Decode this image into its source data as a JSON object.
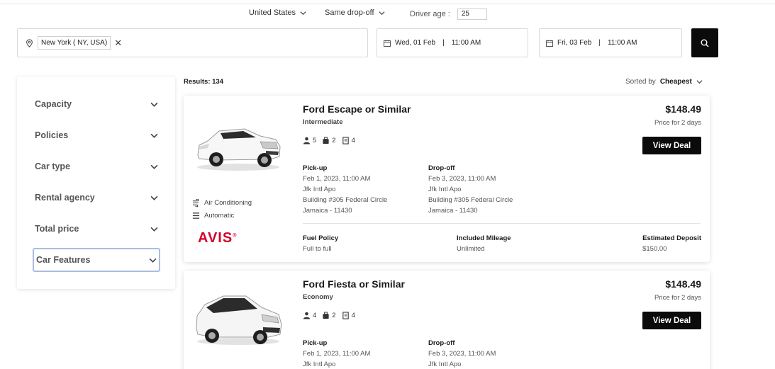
{
  "top_options": {
    "country": "United States",
    "dropoff_mode": "Same drop-off",
    "driver_age_label": "Driver age :",
    "driver_age_value": "25"
  },
  "search": {
    "location": "New York ( NY, USA)",
    "clear_symbol": "✕",
    "pickup_date": "Wed, 01 Feb",
    "pickup_time": "11:00 AM",
    "dropoff_date": "Fri, 03 Feb",
    "dropoff_time": "11:00 AM",
    "date_separator": "|"
  },
  "filters": [
    {
      "label": "Capacity"
    },
    {
      "label": "Policies"
    },
    {
      "label": "Car type"
    },
    {
      "label": "Rental agency"
    },
    {
      "label": "Total price"
    },
    {
      "label": "Car Features"
    }
  ],
  "results": {
    "label": "Results:",
    "count": "134",
    "sorted_prefix": "Sorted by",
    "sorted_value": "Cheapest"
  },
  "cards": [
    {
      "name": "Ford Escape or Similar",
      "class": "Intermediate",
      "seats": "5",
      "bags": "2",
      "doors": "4",
      "price": "$148.49",
      "price_note": "Price for 2 days",
      "deal_label": "View Deal",
      "pickup": {
        "label": "Pick-up",
        "datetime": "Feb 1, 2023, 11:00 AM",
        "station": "Jfk Intl Apo",
        "address": "Building #305 Federal Circle",
        "city": "Jamaica - 11430"
      },
      "dropoff": {
        "label": "Drop-off",
        "datetime": "Feb 3, 2023, 11:00 AM",
        "station": "Jfk Intl Apo",
        "address": "Building #305 Federal Circle",
        "city": "Jamaica - 11430"
      },
      "features": [
        "Air Conditioning",
        "Automatic"
      ],
      "agency": "AVIS",
      "fuel_label": "Fuel Policy",
      "fuel_value": "Full to full",
      "mileage_label": "Included Mileage",
      "mileage_value": "Unlimited",
      "deposit_label": "Estimated Deposit",
      "deposit_value": "$150.00",
      "car_color": "#ffffff"
    },
    {
      "name": "Ford Fiesta or Similar",
      "class": "Economy",
      "seats": "4",
      "bags": "2",
      "doors": "4",
      "price": "$148.49",
      "price_note": "Price for 2 days",
      "deal_label": "View Deal",
      "pickup": {
        "label": "Pick-up",
        "datetime": "Feb 1, 2023, 11:00 AM",
        "station": "Jfk Intl Apo"
      },
      "dropoff": {
        "label": "Drop-off",
        "datetime": "Feb 3, 2023, 11:00 AM",
        "station": "Jfk Intl Apo"
      }
    }
  ],
  "colors": {
    "button_bg": "#0b0b0b",
    "agency_red": "#d4002a",
    "focus_border": "#a9bde0"
  }
}
